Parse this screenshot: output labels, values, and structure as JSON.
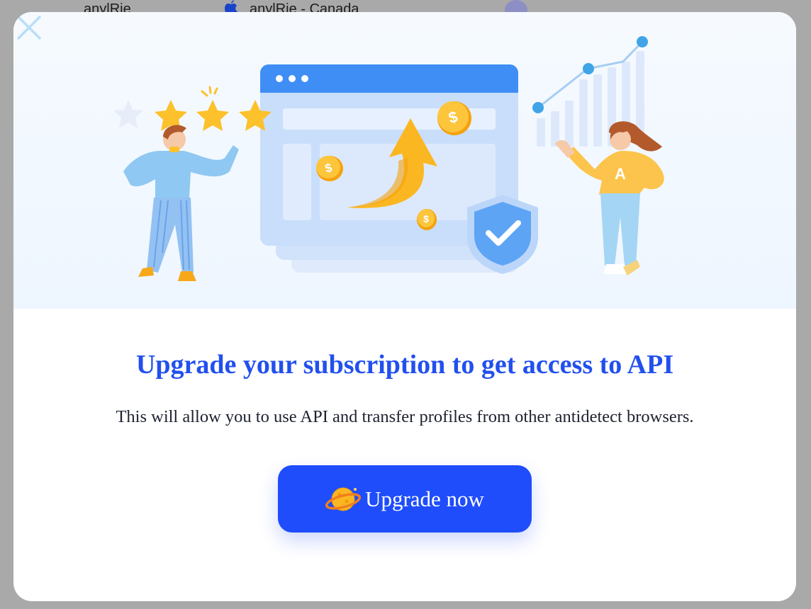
{
  "background": {
    "left_text": "anylRie",
    "right_text": "anylRie - Canada"
  },
  "modal": {
    "title": "Upgrade your subscription to get access to API",
    "description": "This will allow you to use API and transfer profiles from other antidetect browsers.",
    "upgrade_button_label": "Upgrade now",
    "illustration_badge_letter": "A",
    "coin_symbol": "$"
  },
  "colors": {
    "accent": "#1f4dfb",
    "title": "#2250ee",
    "browser_bar": "#3f8ef5",
    "coin": "#fbb722"
  }
}
